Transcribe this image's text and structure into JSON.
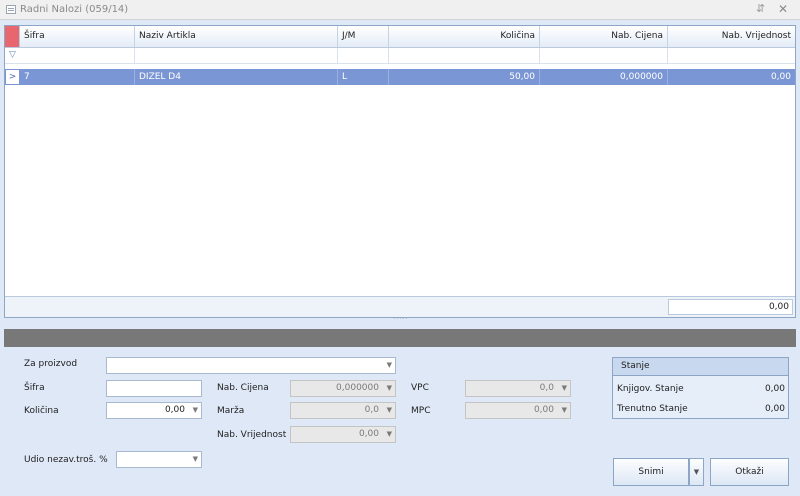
{
  "window": {
    "title": "Radni Nalozi (059/14)",
    "pin_glyph": "⇵",
    "close_glyph": "✕"
  },
  "grid": {
    "columns": [
      "Šifra",
      "Naziv Artikla",
      "J/M",
      "Količina",
      "Nab. Cijena",
      "Nab. Vrijednost"
    ],
    "rows": [
      {
        "sifra": "7",
        "naziv": "DIZEL D4",
        "jm": "L",
        "kolicina": "50,00",
        "nab_cijena": "0,000000",
        "nab_vrijednost": "0,00"
      }
    ],
    "footer_sum": "0,00"
  },
  "form": {
    "za_proizvod": {
      "label": "Za proizvod",
      "value": ""
    },
    "sifra": {
      "label": "Šifra",
      "value": ""
    },
    "kolicina": {
      "label": "Količina",
      "value": "0,00"
    },
    "nab_cijena": {
      "label": "Nab. Cijena",
      "value": "0,000000"
    },
    "marza": {
      "label": "Marža",
      "value": "0,0"
    },
    "nab_vrijednost": {
      "label": "Nab. Vrijednost",
      "value": "0,00"
    },
    "vpc": {
      "label": "VPC",
      "value": "0,0"
    },
    "mpc": {
      "label": "MPC",
      "value": "0,00"
    },
    "udio": {
      "label": "Udio nezav.troš. %",
      "value": ""
    }
  },
  "stanje": {
    "title": "Stanje",
    "knjigov_label": "Knjigov. Stanje",
    "knjigov_value": "0,00",
    "trenutno_label": "Trenutno Stanje",
    "trenutno_value": "0,00"
  },
  "buttons": {
    "snimi": "Snimi",
    "otkazi": "Otkaži"
  },
  "colors": {
    "selected_row": "#7b96d4",
    "indicator": "#e8666e",
    "band": "#787878"
  }
}
